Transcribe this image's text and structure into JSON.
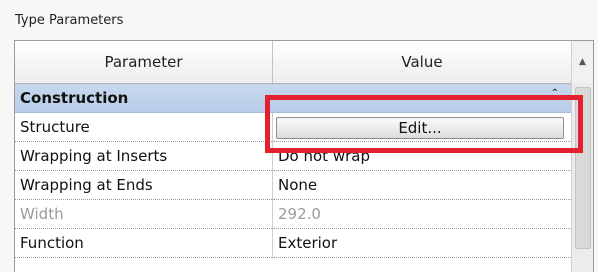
{
  "panel": {
    "title": "Type Parameters"
  },
  "grid": {
    "headers": {
      "parameter": "Parameter",
      "value": "Value"
    },
    "group": {
      "label": "Construction",
      "collapse_icon": "double-chevron-up"
    },
    "rows": [
      {
        "parameter": "Structure",
        "value": "Edit...",
        "kind": "button"
      },
      {
        "parameter": "Wrapping at Inserts",
        "value": "Do not wrap",
        "kind": "text"
      },
      {
        "parameter": "Wrapping at Ends",
        "value": "None",
        "kind": "text"
      },
      {
        "parameter": "Width",
        "value": "292.0",
        "kind": "readonly"
      },
      {
        "parameter": "Function",
        "value": "Exterior",
        "kind": "text"
      }
    ]
  },
  "scrollbar": {
    "up_icon": "triangle-up"
  },
  "annotation": {
    "highlight_color": "#e3202f"
  }
}
